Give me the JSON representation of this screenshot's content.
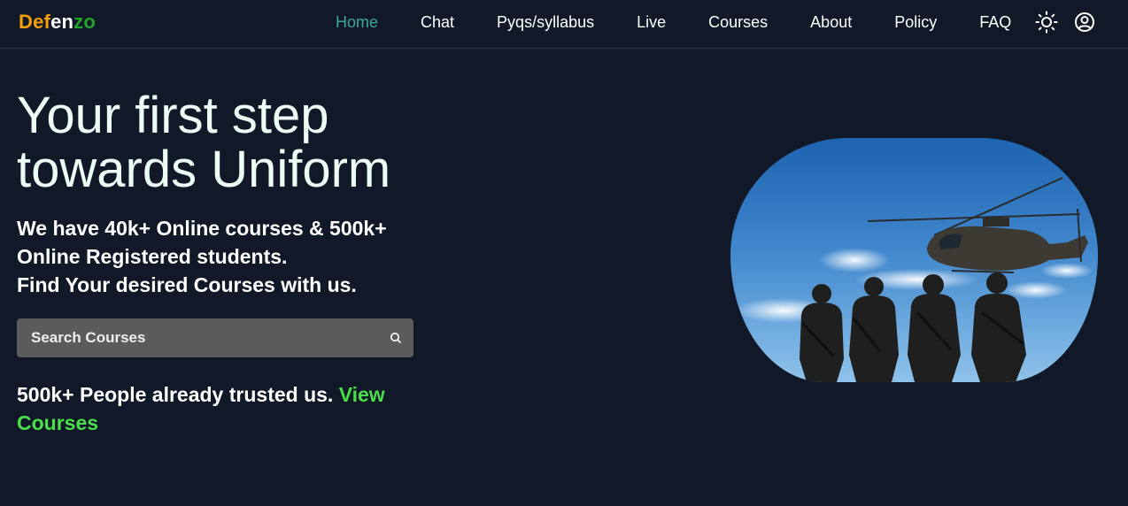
{
  "brand": {
    "part1": "Def",
    "part2": "en",
    "part3": "zo"
  },
  "nav": {
    "items": [
      {
        "label": "Home",
        "active": true
      },
      {
        "label": "Chat"
      },
      {
        "label": "Pyqs/syllabus"
      },
      {
        "label": "Live"
      },
      {
        "label": "Courses"
      },
      {
        "label": "About"
      },
      {
        "label": "Policy"
      },
      {
        "label": "FAQ"
      }
    ],
    "icons": {
      "theme": "sun-icon",
      "account": "user-circle-icon"
    }
  },
  "hero": {
    "title": "Your first step towards Uniform",
    "subtitle_line1": "We have 40k+ Online courses & 500k+",
    "subtitle_line2": "Online Registered students.",
    "subtitle_line3": "Find Your desired Courses with us.",
    "search": {
      "placeholder": "Search Courses",
      "value": ""
    },
    "trust_text": "500k+ People already trusted us.",
    "trust_link": "View Courses"
  },
  "colors": {
    "background": "#111827",
    "accent_active": "#3da79c",
    "link_green": "#4ade4a",
    "logo_orange": "#f59e0b",
    "logo_green": "#22a32a"
  }
}
